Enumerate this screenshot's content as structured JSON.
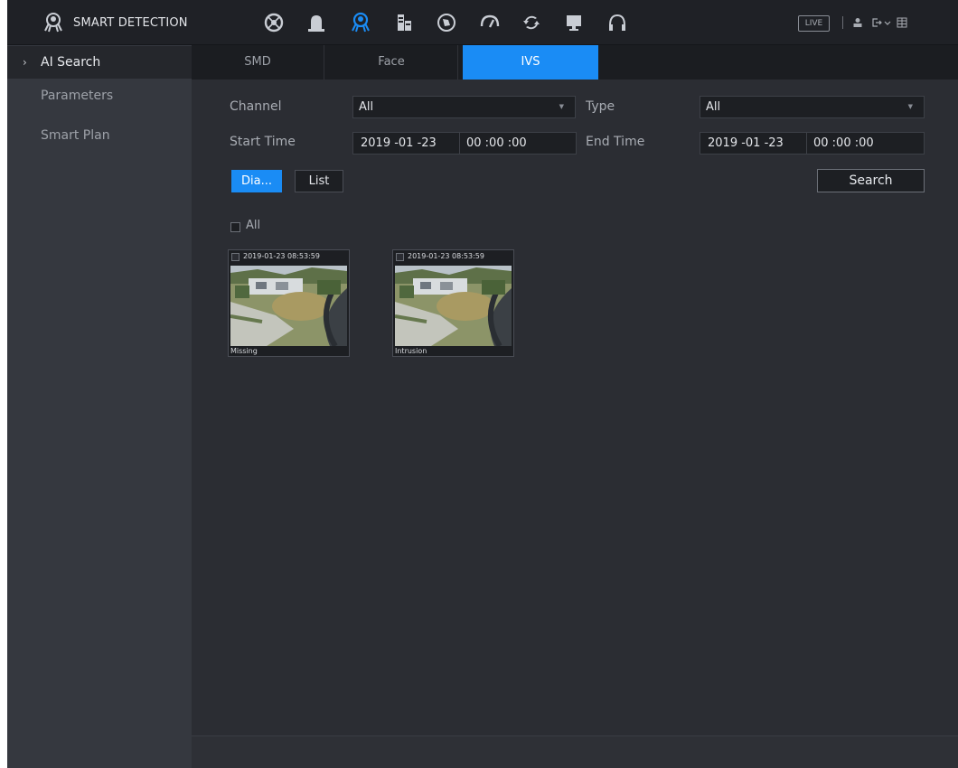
{
  "header": {
    "title": "SMART DETECTION",
    "live_label": "LIVE",
    "icons": [
      "smart-detection-logo-icon",
      "camera-icon",
      "alarm-icon",
      "smart-search-icon",
      "storage-icon",
      "network-icon",
      "performance-icon",
      "backup-icon",
      "display-icon",
      "audio-icon",
      "user-icon",
      "logout-icon",
      "grid-icon"
    ]
  },
  "sidebar": {
    "items": [
      {
        "label": "AI Search",
        "active": true
      },
      {
        "label": "Parameters",
        "active": false
      },
      {
        "label": "Smart Plan",
        "active": false
      }
    ]
  },
  "tabs": [
    {
      "label": "SMD",
      "active": false
    },
    {
      "label": "Face",
      "active": false
    },
    {
      "label": "IVS",
      "active": true
    }
  ],
  "form": {
    "channel_label": "Channel",
    "channel_value": "All",
    "type_label": "Type",
    "type_value": "All",
    "start_label": "Start Time",
    "start_date": "2019 -01 -23",
    "start_time": "00 :00 :00",
    "end_label": "End Time",
    "end_date": "2019 -01 -23",
    "end_time": "00 :00 :00",
    "view_diagram": "Dia...",
    "view_list": "List",
    "search_label": "Search",
    "all_label": "All"
  },
  "results": [
    {
      "timestamp": "2019-01-23 08:53:59",
      "event": "Missing"
    },
    {
      "timestamp": "2019-01-23 08:53:59",
      "event": "Intrusion"
    }
  ],
  "colors": {
    "accent": "#1a8cf5",
    "background": "#2b2d33",
    "sidebar": "#35383f",
    "topbar": "#1f2126"
  }
}
